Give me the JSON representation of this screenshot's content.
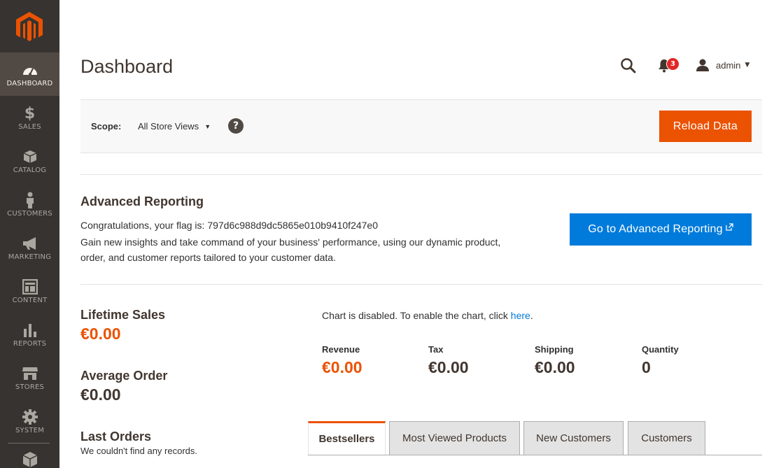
{
  "colors": {
    "sidebar_bg": "#373330",
    "sidebar_active": "#514943",
    "accent_orange": "#eb5202",
    "link_blue": "#007bdb",
    "notification_red": "#e22626"
  },
  "sidebar": {
    "logo": "magento-logo",
    "items": [
      {
        "label": "DASHBOARD",
        "icon": "speedometer-icon",
        "active": true
      },
      {
        "label": "SALES",
        "icon": "dollar-icon"
      },
      {
        "label": "CATALOG",
        "icon": "box-icon"
      },
      {
        "label": "CUSTOMERS",
        "icon": "person-icon"
      },
      {
        "label": "MARKETING",
        "icon": "megaphone-icon"
      },
      {
        "label": "CONTENT",
        "icon": "layout-icon"
      },
      {
        "label": "REPORTS",
        "icon": "bar-chart-icon"
      },
      {
        "label": "STORES",
        "icon": "storefront-icon"
      },
      {
        "label": "SYSTEM",
        "icon": "gear-icon"
      },
      {
        "label": "",
        "icon": "cube-icon"
      }
    ]
  },
  "header": {
    "title": "Dashboard",
    "notifications_count": "3",
    "user_name": "admin"
  },
  "scope": {
    "label": "Scope:",
    "selected": "All Store Views",
    "help": "?",
    "reload_button": "Reload Data"
  },
  "advanced_reporting": {
    "title": "Advanced Reporting",
    "line1": "Congratulations, your flag is: 797d6c988d9dc5865e010b9410f247e0",
    "line2": "Gain new insights and take command of your business' performance, using our dynamic product,",
    "line3": "order, and customer reports tailored to your customer data.",
    "button": "Go to Advanced Reporting"
  },
  "sales": {
    "lifetime_title": "Lifetime Sales",
    "lifetime_value": "€0.00",
    "average_title": "Average Order",
    "average_value": "€0.00",
    "last_orders_title": "Last Orders",
    "last_orders_empty": "We couldn't find any records."
  },
  "chart": {
    "message": "Chart is disabled. To enable the chart, click ",
    "link": "here",
    "after": "."
  },
  "totals": [
    {
      "label": "Revenue",
      "value": "€0.00"
    },
    {
      "label": "Tax",
      "value": "€0.00"
    },
    {
      "label": "Shipping",
      "value": "€0.00"
    },
    {
      "label": "Quantity",
      "value": "0"
    }
  ],
  "tabs": [
    {
      "label": "Bestsellers",
      "active": true
    },
    {
      "label": "Most Viewed Products"
    },
    {
      "label": "New Customers"
    },
    {
      "label": "Customers"
    }
  ]
}
